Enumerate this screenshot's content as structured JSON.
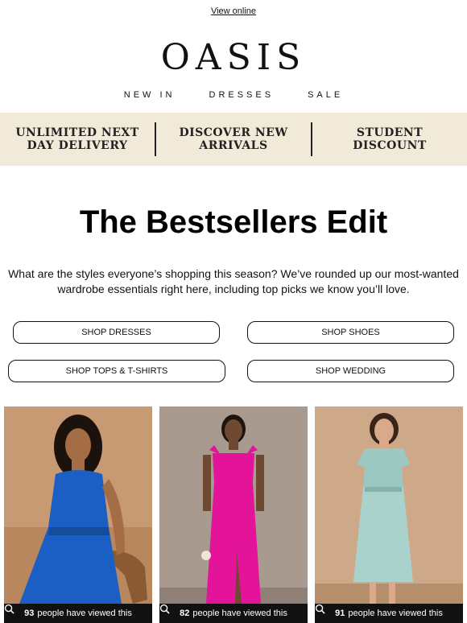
{
  "header": {
    "view_online": "View online",
    "logo": "OASIS",
    "nav": [
      "NEW IN",
      "DRESSES",
      "SALE"
    ]
  },
  "banner": {
    "items": [
      [
        "UNLIMITED NEXT",
        "DAY DELIVERY"
      ],
      [
        "DISCOVER NEW",
        "ARRIVALS"
      ],
      [
        "STUDENT",
        "DISCOUNT"
      ]
    ]
  },
  "main": {
    "title": "The Bestsellers Edit",
    "intro": "What are the styles everyone’s shopping this season? We’ve rounded up our most-wanted wardrobe essentials right here, including top picks we know you’ll love."
  },
  "buttons": {
    "dresses": "SHOP DRESSES",
    "shoes": "SHOP SHOES",
    "tops": "SHOP TOPS & T-SHIRTS",
    "wedding": "SHOP WEDDING"
  },
  "products": [
    {
      "count": "93",
      "suffix": "people have viewed this",
      "dress_color": "#1c5fc4",
      "bg_color": "#c79a73"
    },
    {
      "count": "82",
      "suffix": "people have viewed this",
      "dress_color": "#e3149a",
      "bg_color": "#a89a8f"
    },
    {
      "count": "91",
      "suffix": "people have viewed this",
      "dress_color": "#9cc8c2",
      "bg_color": "#cda98a"
    }
  ],
  "icons": {
    "views": "search-icon"
  }
}
